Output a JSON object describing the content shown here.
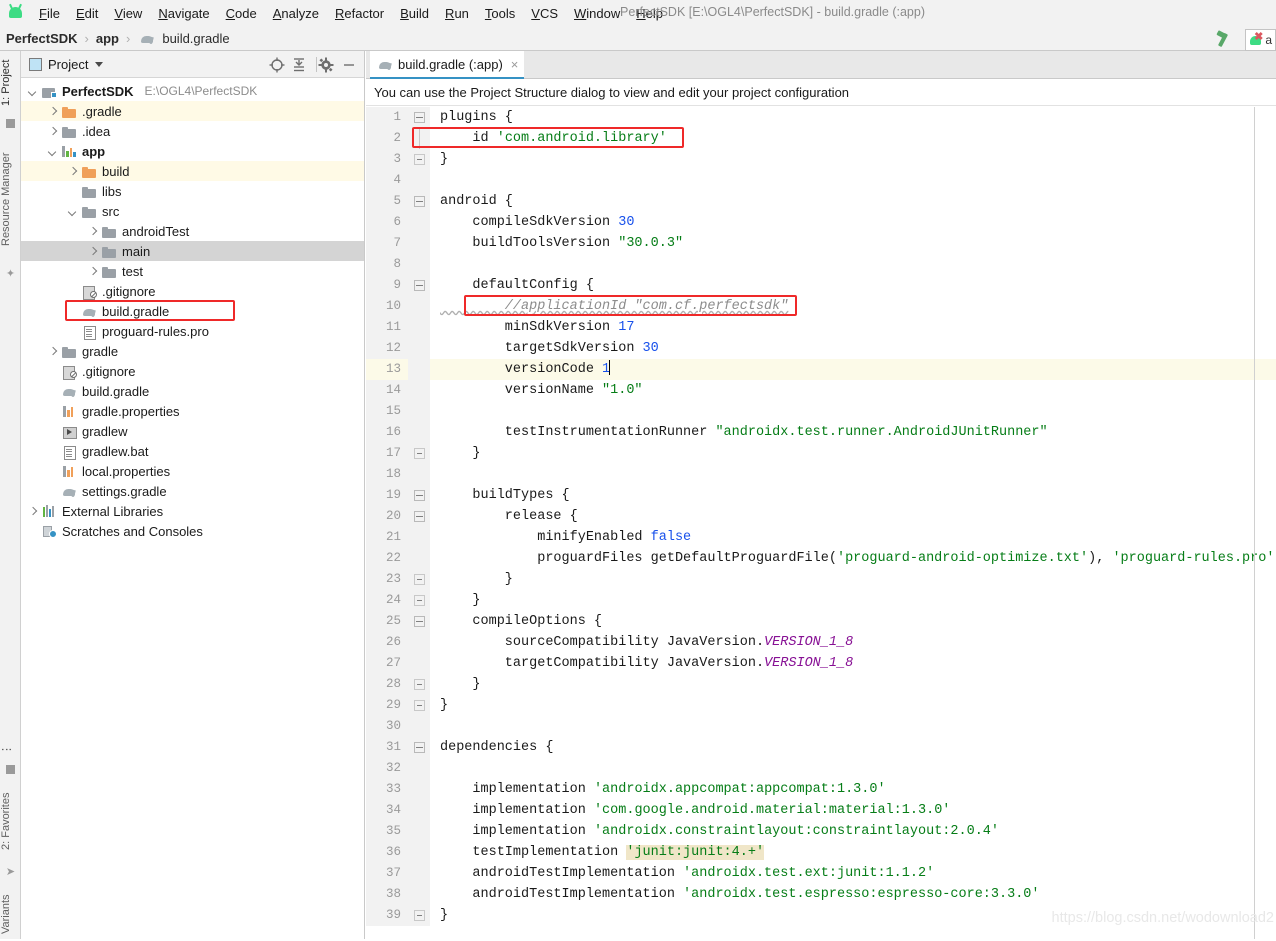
{
  "window": {
    "title": "PerfectSDK [E:\\OGL4\\PerfectSDK] - build.gradle (:app)",
    "accent_blue": "#3592c4",
    "highlight_red": "#ef2929",
    "android_green": "#3ddc84"
  },
  "menu": {
    "items": [
      {
        "label": "File",
        "mnemonic": "F"
      },
      {
        "label": "Edit",
        "mnemonic": "E"
      },
      {
        "label": "View",
        "mnemonic": "V"
      },
      {
        "label": "Navigate",
        "mnemonic": "N"
      },
      {
        "label": "Code",
        "mnemonic": "C"
      },
      {
        "label": "Analyze",
        "mnemonic": "A"
      },
      {
        "label": "Refactor",
        "mnemonic": "R"
      },
      {
        "label": "Build",
        "mnemonic": "B"
      },
      {
        "label": "Run",
        "mnemonic": "R"
      },
      {
        "label": "Tools",
        "mnemonic": "T"
      },
      {
        "label": "VCS",
        "mnemonic": "V"
      },
      {
        "label": "Window",
        "mnemonic": "W"
      },
      {
        "label": "Help",
        "mnemonic": "H"
      }
    ]
  },
  "breadcrumb": {
    "items": [
      "PerfectSDK",
      "app",
      "build.gradle"
    ],
    "separator": "›"
  },
  "toolbar_right": {
    "hammer_icon": "hammer-icon",
    "run_config_label": "a",
    "run_config_icon": "android-error-icon"
  },
  "left_strips": {
    "top": [
      {
        "label": "1: Project",
        "selected": true
      },
      {
        "label": "Resource Manager",
        "selected": false
      }
    ],
    "bottom": [
      {
        "label": "2: Favorites",
        "selected": false
      },
      {
        "label": "Variants",
        "selected": false
      }
    ]
  },
  "project_panel": {
    "title": "Project",
    "buttons": [
      {
        "name": "locate-icon",
        "label": ""
      },
      {
        "name": "collapse-all-icon",
        "label": ""
      },
      {
        "name": "gear-icon",
        "label": ""
      },
      {
        "name": "hide-icon",
        "label": ""
      }
    ],
    "tree": [
      {
        "label": "PerfectSDK",
        "path": "E:\\OGL4\\PerfectSDK",
        "indent": 0,
        "arrow": "down",
        "icon": "root",
        "bold": true,
        "hl": "none"
      },
      {
        "label": ".gradle",
        "path": "",
        "indent": 1,
        "arrow": "right",
        "icon": "folder-o",
        "bold": false,
        "hl": "yellow"
      },
      {
        "label": ".idea",
        "path": "",
        "indent": 1,
        "arrow": "right",
        "icon": "folder",
        "bold": false,
        "hl": "none"
      },
      {
        "label": "app",
        "path": "",
        "indent": 1,
        "arrow": "down",
        "icon": "module",
        "bold": true,
        "hl": "none"
      },
      {
        "label": "build",
        "path": "",
        "indent": 2,
        "arrow": "right",
        "icon": "folder-o",
        "bold": false,
        "hl": "yellow"
      },
      {
        "label": "libs",
        "path": "",
        "indent": 2,
        "arrow": "none",
        "icon": "folder",
        "bold": false,
        "hl": "none"
      },
      {
        "label": "src",
        "path": "",
        "indent": 2,
        "arrow": "down",
        "icon": "folder",
        "bold": false,
        "hl": "none"
      },
      {
        "label": "androidTest",
        "path": "",
        "indent": 3,
        "arrow": "right",
        "icon": "folder",
        "bold": false,
        "hl": "none"
      },
      {
        "label": "main",
        "path": "",
        "indent": 3,
        "arrow": "right",
        "icon": "folder",
        "bold": false,
        "hl": "grey"
      },
      {
        "label": "test",
        "path": "",
        "indent": 3,
        "arrow": "right",
        "icon": "folder",
        "bold": false,
        "hl": "none"
      },
      {
        "label": ".gitignore",
        "path": "",
        "indent": 2,
        "arrow": "none",
        "icon": "git",
        "bold": false,
        "hl": "none"
      },
      {
        "label": "build.gradle",
        "path": "",
        "indent": 2,
        "arrow": "none",
        "icon": "gradle",
        "bold": false,
        "hl": "none",
        "boxed": true
      },
      {
        "label": "proguard-rules.pro",
        "path": "",
        "indent": 2,
        "arrow": "none",
        "icon": "doc",
        "bold": false,
        "hl": "none"
      },
      {
        "label": "gradle",
        "path": "",
        "indent": 1,
        "arrow": "right",
        "icon": "folder",
        "bold": false,
        "hl": "none"
      },
      {
        "label": ".gitignore",
        "path": "",
        "indent": 1,
        "arrow": "none",
        "icon": "git",
        "bold": false,
        "hl": "none"
      },
      {
        "label": "build.gradle",
        "path": "",
        "indent": 1,
        "arrow": "none",
        "icon": "gradle",
        "bold": false,
        "hl": "none"
      },
      {
        "label": "gradle.properties",
        "path": "",
        "indent": 1,
        "arrow": "none",
        "icon": "props",
        "bold": false,
        "hl": "none"
      },
      {
        "label": "gradlew",
        "path": "",
        "indent": 1,
        "arrow": "none",
        "icon": "script",
        "bold": false,
        "hl": "none"
      },
      {
        "label": "gradlew.bat",
        "path": "",
        "indent": 1,
        "arrow": "none",
        "icon": "doc",
        "bold": false,
        "hl": "none"
      },
      {
        "label": "local.properties",
        "path": "",
        "indent": 1,
        "arrow": "none",
        "icon": "props",
        "bold": false,
        "hl": "none"
      },
      {
        "label": "settings.gradle",
        "path": "",
        "indent": 1,
        "arrow": "none",
        "icon": "gradle",
        "bold": false,
        "hl": "none"
      },
      {
        "label": "External Libraries",
        "path": "",
        "indent": 0,
        "arrow": "right",
        "icon": "lib",
        "bold": false,
        "hl": "none"
      },
      {
        "label": "Scratches and Consoles",
        "path": "",
        "indent": 0,
        "arrow": "none",
        "icon": "scratch",
        "bold": false,
        "hl": "none"
      }
    ]
  },
  "editor": {
    "tab": {
      "label": "build.gradle (:app)",
      "close": "×",
      "icon": "gradle-icon"
    },
    "notification": "You can use the Project Structure dialog to view and edit your project configuration",
    "current_line": 13,
    "watermark": "https://blog.csdn.net/wodownload2",
    "lines": [
      {
        "n": 1,
        "fold": "minus",
        "tokens": [
          {
            "t": "plugins {"
          }
        ]
      },
      {
        "n": 2,
        "fold": "tail",
        "boxed": true,
        "tokens": [
          {
            "t": "    id "
          },
          {
            "t": "'com.android.library'",
            "c": "k-str"
          }
        ]
      },
      {
        "n": 3,
        "fold": "end",
        "tokens": [
          {
            "t": "}"
          }
        ]
      },
      {
        "n": 4,
        "fold": "none",
        "tokens": [
          {
            "t": ""
          }
        ]
      },
      {
        "n": 5,
        "fold": "minus",
        "tokens": [
          {
            "t": "android {"
          }
        ]
      },
      {
        "n": 6,
        "fold": "none",
        "tokens": [
          {
            "t": "    compileSdkVersion "
          },
          {
            "t": "30",
            "c": "k-num"
          }
        ]
      },
      {
        "n": 7,
        "fold": "none",
        "tokens": [
          {
            "t": "    buildToolsVersion "
          },
          {
            "t": "\"30.0.3\"",
            "c": "k-str"
          }
        ]
      },
      {
        "n": 8,
        "fold": "none",
        "tokens": [
          {
            "t": ""
          }
        ]
      },
      {
        "n": 9,
        "fold": "minus2",
        "tokens": [
          {
            "t": "    defaultConfig {"
          }
        ]
      },
      {
        "n": 10,
        "fold": "none",
        "boxed": true,
        "tokens": [
          {
            "t": "        //applicationId \"com.cf.perfectsdk\"",
            "c": "k-com k-sq"
          }
        ]
      },
      {
        "n": 11,
        "fold": "none",
        "tokens": [
          {
            "t": "        minSdkVersion "
          },
          {
            "t": "17",
            "c": "k-num"
          }
        ]
      },
      {
        "n": 12,
        "fold": "none",
        "tokens": [
          {
            "t": "        targetSdkVersion "
          },
          {
            "t": "30",
            "c": "k-num"
          }
        ]
      },
      {
        "n": 13,
        "fold": "none",
        "hl": true,
        "caret": true,
        "tokens": [
          {
            "t": "        versionCode "
          },
          {
            "t": "1",
            "c": "k-num"
          }
        ]
      },
      {
        "n": 14,
        "fold": "none",
        "tokens": [
          {
            "t": "        versionName "
          },
          {
            "t": "\"1.0\"",
            "c": "k-str"
          }
        ]
      },
      {
        "n": 15,
        "fold": "none",
        "tokens": [
          {
            "t": ""
          }
        ]
      },
      {
        "n": 16,
        "fold": "none",
        "tokens": [
          {
            "t": "        testInstrumentationRunner "
          },
          {
            "t": "\"androidx.test.runner.AndroidJUnitRunner\"",
            "c": "k-str"
          }
        ]
      },
      {
        "n": 17,
        "fold": "end2",
        "tokens": [
          {
            "t": "    }"
          }
        ]
      },
      {
        "n": 18,
        "fold": "none",
        "tokens": [
          {
            "t": ""
          }
        ]
      },
      {
        "n": 19,
        "fold": "minus2",
        "tokens": [
          {
            "t": "    buildTypes {"
          }
        ]
      },
      {
        "n": 20,
        "fold": "minus3",
        "tokens": [
          {
            "t": "        release {"
          }
        ]
      },
      {
        "n": 21,
        "fold": "none",
        "tokens": [
          {
            "t": "            minifyEnabled "
          },
          {
            "t": "false",
            "c": "k-kw"
          }
        ]
      },
      {
        "n": 22,
        "fold": "none",
        "tokens": [
          {
            "t": "            proguardFiles getDefaultProguardFile("
          },
          {
            "t": "'proguard-android-optimize.txt'",
            "c": "k-str"
          },
          {
            "t": "), "
          },
          {
            "t": "'proguard-rules.pro'",
            "c": "k-str"
          }
        ]
      },
      {
        "n": 23,
        "fold": "end3",
        "tokens": [
          {
            "t": "        }"
          }
        ]
      },
      {
        "n": 24,
        "fold": "end2",
        "tokens": [
          {
            "t": "    }"
          }
        ]
      },
      {
        "n": 25,
        "fold": "minus2",
        "tokens": [
          {
            "t": "    compileOptions {"
          }
        ]
      },
      {
        "n": 26,
        "fold": "none",
        "tokens": [
          {
            "t": "        sourceCompatibility JavaVersion."
          },
          {
            "t": "VERSION_1_8",
            "c": "k-fld"
          }
        ]
      },
      {
        "n": 27,
        "fold": "none",
        "tokens": [
          {
            "t": "        targetCompatibility JavaVersion."
          },
          {
            "t": "VERSION_1_8",
            "c": "k-fld"
          }
        ]
      },
      {
        "n": 28,
        "fold": "end2",
        "tokens": [
          {
            "t": "    }"
          }
        ]
      },
      {
        "n": 29,
        "fold": "end",
        "tokens": [
          {
            "t": "}"
          }
        ]
      },
      {
        "n": 30,
        "fold": "none",
        "tokens": [
          {
            "t": ""
          }
        ]
      },
      {
        "n": 31,
        "fold": "minus",
        "tokens": [
          {
            "t": "dependencies {"
          }
        ]
      },
      {
        "n": 32,
        "fold": "none",
        "tokens": [
          {
            "t": ""
          }
        ]
      },
      {
        "n": 33,
        "fold": "none",
        "tokens": [
          {
            "t": "    implementation "
          },
          {
            "t": "'androidx.appcompat:appcompat:1.3.0'",
            "c": "k-str"
          }
        ]
      },
      {
        "n": 34,
        "fold": "none",
        "tokens": [
          {
            "t": "    implementation "
          },
          {
            "t": "'com.google.android.material:material:1.3.0'",
            "c": "k-str"
          }
        ]
      },
      {
        "n": 35,
        "fold": "none",
        "tokens": [
          {
            "t": "    implementation "
          },
          {
            "t": "'androidx.constraintlayout:constraintlayout:2.0.4'",
            "c": "k-str"
          }
        ]
      },
      {
        "n": 36,
        "fold": "none",
        "tokens": [
          {
            "t": "    testImplementation "
          },
          {
            "t": "'junit:junit:4.+'",
            "c": "k-str k-hl"
          }
        ]
      },
      {
        "n": 37,
        "fold": "none",
        "tokens": [
          {
            "t": "    androidTestImplementation "
          },
          {
            "t": "'androidx.test.ext:junit:1.1.2'",
            "c": "k-str"
          }
        ]
      },
      {
        "n": 38,
        "fold": "none",
        "tokens": [
          {
            "t": "    androidTestImplementation "
          },
          {
            "t": "'androidx.test.espresso:espresso-core:3.3.0'",
            "c": "k-str"
          }
        ]
      },
      {
        "n": 39,
        "fold": "end",
        "tokens": [
          {
            "t": "}"
          }
        ]
      }
    ]
  }
}
